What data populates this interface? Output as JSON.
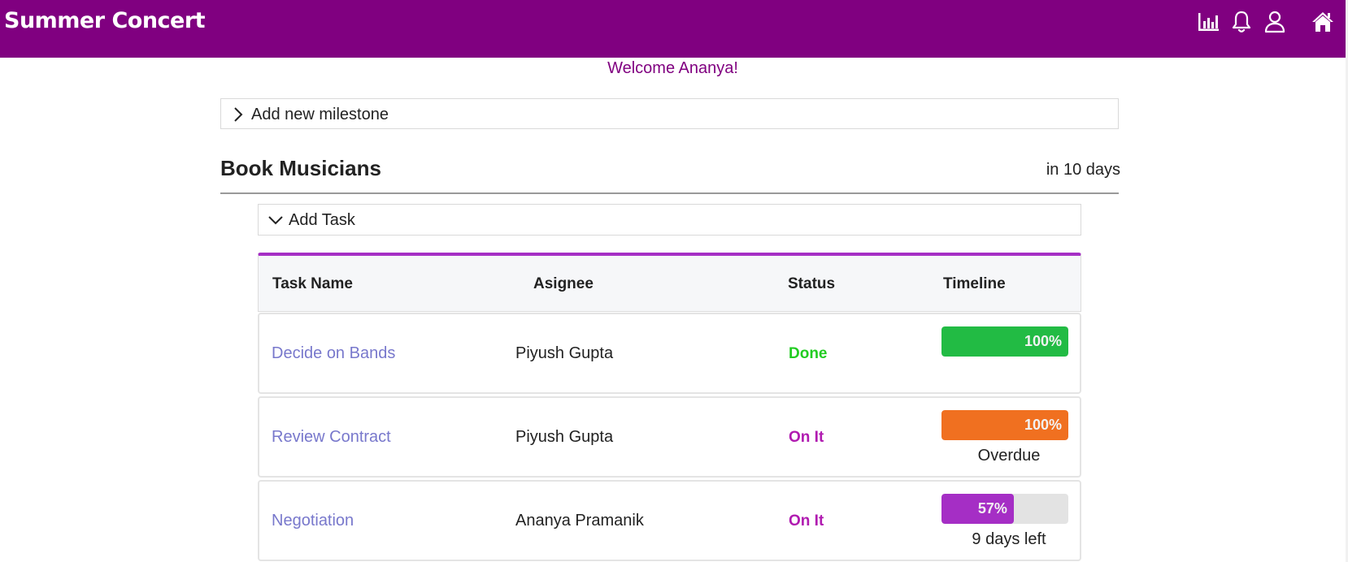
{
  "app": {
    "title": "Summer Concert",
    "brand_color": "#800080",
    "icons": [
      "bar-chart-icon",
      "bell-icon",
      "user-icon",
      "home-icon"
    ]
  },
  "welcome": "Welcome Ananya!",
  "milestone": {
    "add_label": "Add new milestone",
    "title": "Book Musicians",
    "due": "in 10 days"
  },
  "add_task_label": "Add Task",
  "table": {
    "headers": [
      "Task Name",
      "Asignee",
      "Status",
      "Timeline"
    ],
    "rows": [
      {
        "task": "Decide on Bands",
        "assignee": "Piyush Gupta",
        "status": "Done",
        "status_color": "#22cc22",
        "progress": 100,
        "progress_label": "100%",
        "bar_color": "#22bb44",
        "note": ""
      },
      {
        "task": "Review Contract",
        "assignee": "Piyush Gupta",
        "status": "On It",
        "status_color": "#b01ab0",
        "progress": 100,
        "progress_label": "100%",
        "bar_color": "#f07020",
        "note": "Overdue"
      },
      {
        "task": "Negotiation",
        "assignee": "Ananya Pramanik",
        "status": "On It",
        "status_color": "#b01ab0",
        "progress": 57,
        "progress_label": "57%",
        "bar_color": "#a52ec5",
        "note": "9 days left"
      }
    ]
  }
}
